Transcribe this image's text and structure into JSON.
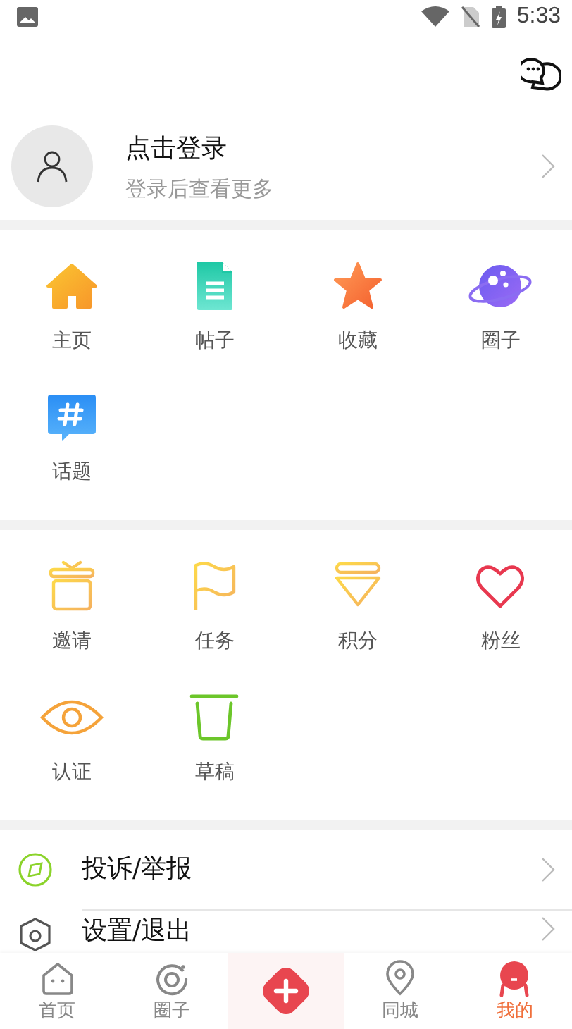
{
  "status_bar": {
    "time": "5:33"
  },
  "profile": {
    "title": "点击登录",
    "subtitle": "登录后查看更多"
  },
  "shortcut_groups": [
    {
      "items": [
        {
          "label": "主页"
        },
        {
          "label": "帖子"
        },
        {
          "label": "收藏"
        },
        {
          "label": "圈子"
        },
        {
          "label": "话题"
        }
      ]
    },
    {
      "items": [
        {
          "label": "邀请"
        },
        {
          "label": "任务"
        },
        {
          "label": "积分"
        },
        {
          "label": "粉丝"
        },
        {
          "label": "认证"
        },
        {
          "label": "草稿"
        }
      ]
    }
  ],
  "menu": [
    {
      "label": "投诉/举报"
    },
    {
      "label": "设置/退出"
    }
  ],
  "tab_bar": [
    {
      "kind": "tab",
      "label": "首页",
      "selected": false
    },
    {
      "kind": "tab",
      "label": "圈子",
      "selected": false
    },
    {
      "kind": "action",
      "selected": false
    },
    {
      "kind": "tab",
      "label": "同城",
      "selected": false
    },
    {
      "kind": "tab",
      "label": "我的",
      "selected": true
    }
  ]
}
